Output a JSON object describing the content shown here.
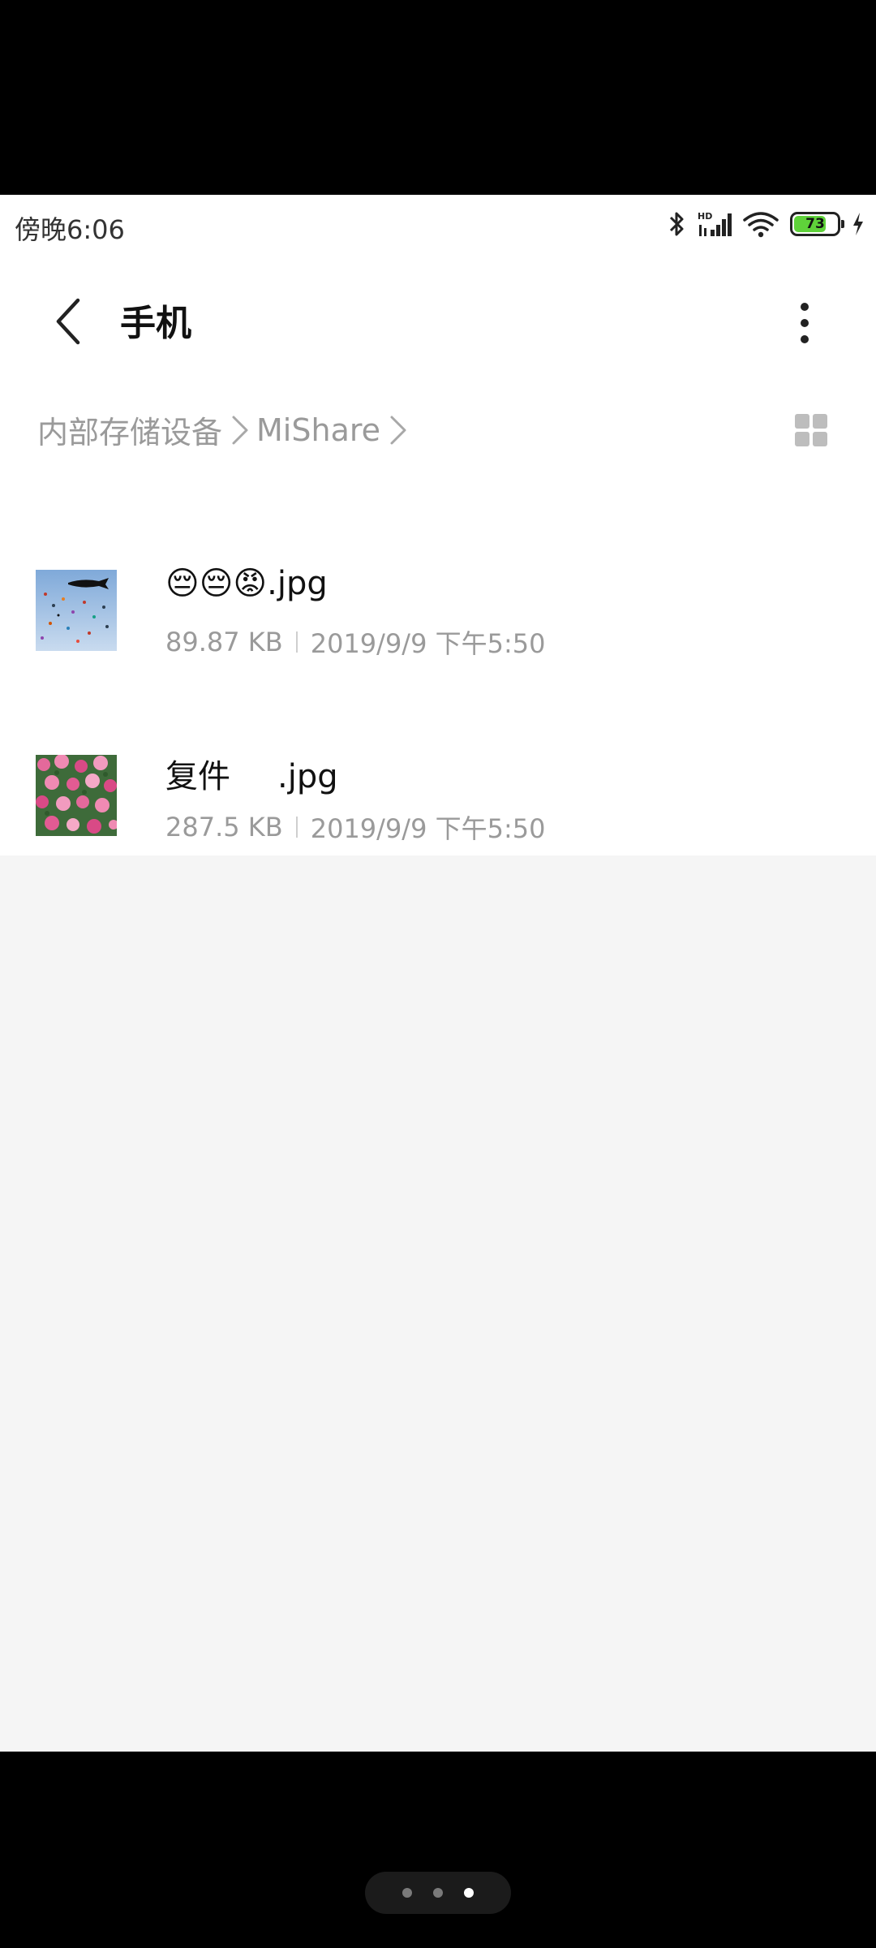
{
  "status_bar": {
    "time": "傍晚6:06",
    "battery_level": "73",
    "icons": [
      "bluetooth-icon",
      "hd-signal-icon",
      "wifi-icon",
      "battery-icon",
      "charging-icon"
    ]
  },
  "header": {
    "title": "手机",
    "back_icon": "chevron-left-icon",
    "more_icon": "more-vertical-icon"
  },
  "breadcrumb": {
    "items": [
      "内部存储设备",
      "MiShare"
    ],
    "view_toggle_icon": "grid-view-icon"
  },
  "files": [
    {
      "name_emoji": "😔😔😡",
      "name_suffix": ".jpg",
      "size": "89.87 KB",
      "date": "2019/9/9 下午5:50"
    },
    {
      "name_prefix": "复件",
      "name_suffix": ".jpg",
      "size": "287.5 KB",
      "date": "2019/9/9 下午5:50"
    }
  ],
  "nav": {
    "page_count": 3,
    "active_index": 2
  }
}
